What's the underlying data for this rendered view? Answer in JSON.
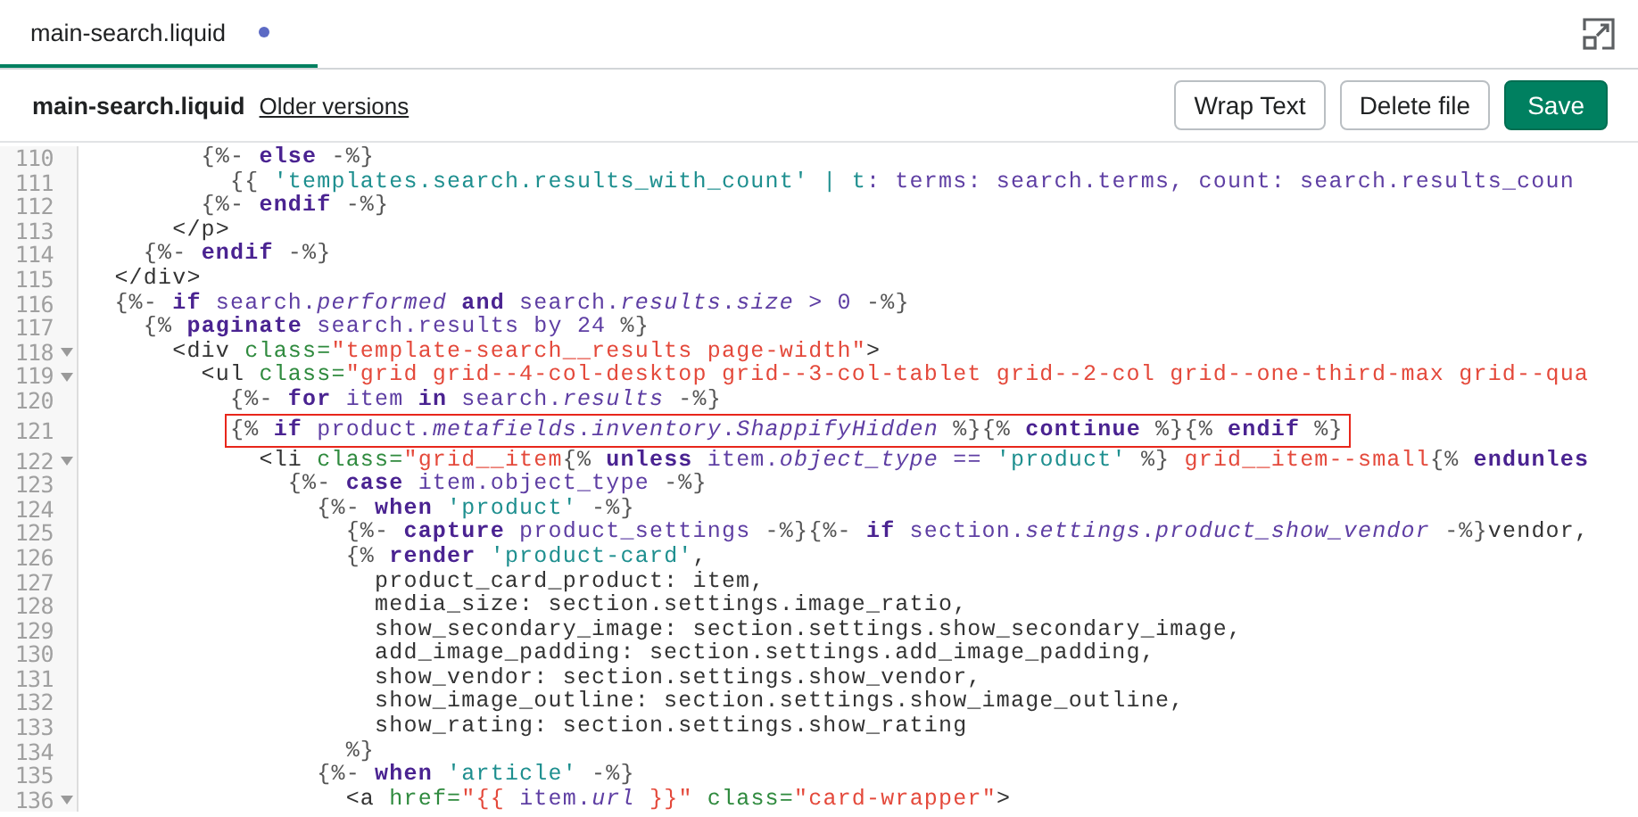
{
  "tabs": [
    {
      "label": "main-search.liquid",
      "selected": true,
      "unsaved": true
    }
  ],
  "toolbar": {
    "file_name": "main-search.liquid",
    "link": "Older versions",
    "buttons": [
      {
        "label": "Wrap Text",
        "kind": "secondary"
      },
      {
        "label": "Delete file",
        "kind": "secondary"
      },
      {
        "label": "Save",
        "kind": "primary"
      }
    ]
  },
  "editor": {
    "lines": [
      {
        "number": "110",
        "foldable": false,
        "highlighted": false,
        "tokens": [
          {
            "kind": "delim",
            "text": "        {%- "
          },
          {
            "kind": "keyword",
            "text": "else"
          },
          {
            "kind": "delim",
            "text": " -%}"
          }
        ]
      },
      {
        "number": "111",
        "foldable": false,
        "highlighted": false,
        "tokens": [
          {
            "kind": "delim",
            "text": "          {{ "
          },
          {
            "kind": "string",
            "text": "'templates.search.results_with_count'"
          },
          {
            "kind": "string",
            "text": " | t"
          },
          {
            "kind": "var",
            "text": ": terms: search.terms, count: search.results_coun"
          }
        ]
      },
      {
        "number": "112",
        "foldable": false,
        "highlighted": false,
        "tokens": [
          {
            "kind": "delim",
            "text": "        {%- "
          },
          {
            "kind": "keyword",
            "text": "endif"
          },
          {
            "kind": "delim",
            "text": " -%}"
          }
        ]
      },
      {
        "number": "113",
        "foldable": false,
        "highlighted": false,
        "tokens": [
          {
            "kind": "tag",
            "text": "      </p>"
          }
        ]
      },
      {
        "number": "114",
        "foldable": false,
        "highlighted": false,
        "tokens": [
          {
            "kind": "delim",
            "text": "    {%- "
          },
          {
            "kind": "keyword",
            "text": "endif"
          },
          {
            "kind": "delim",
            "text": " -%}"
          }
        ]
      },
      {
        "number": "115",
        "foldable": false,
        "highlighted": false,
        "tokens": [
          {
            "kind": "tag",
            "text": "  </div>"
          }
        ]
      },
      {
        "number": "116",
        "foldable": false,
        "highlighted": false,
        "tokens": [
          {
            "kind": "delim",
            "text": "  {%- "
          },
          {
            "kind": "keyword",
            "text": "if"
          },
          {
            "kind": "var",
            "text": " search."
          },
          {
            "kind": "prop",
            "text": "performed"
          },
          {
            "kind": "keyword",
            "text": " and"
          },
          {
            "kind": "var",
            "text": " search."
          },
          {
            "kind": "prop",
            "text": "results"
          },
          {
            "kind": "var",
            "text": "."
          },
          {
            "kind": "prop",
            "text": "size"
          },
          {
            "kind": "var",
            "text": " > 0"
          },
          {
            "kind": "delim",
            "text": " -%}"
          }
        ]
      },
      {
        "number": "117",
        "foldable": false,
        "highlighted": false,
        "tokens": [
          {
            "kind": "delim",
            "text": "    {% "
          },
          {
            "kind": "keyword",
            "text": "paginate"
          },
          {
            "kind": "var",
            "text": " search.results by 24"
          },
          {
            "kind": "delim",
            "text": " %}"
          }
        ]
      },
      {
        "number": "118",
        "foldable": true,
        "highlighted": false,
        "tokens": [
          {
            "kind": "tag",
            "text": "      <div "
          },
          {
            "kind": "attr",
            "text": "class="
          },
          {
            "kind": "value",
            "text": "\"template-search__results page-width\""
          },
          {
            "kind": "tag",
            "text": ">"
          }
        ]
      },
      {
        "number": "119",
        "foldable": true,
        "highlighted": false,
        "tokens": [
          {
            "kind": "tag",
            "text": "        <ul "
          },
          {
            "kind": "attr",
            "text": "class="
          },
          {
            "kind": "value",
            "text": "\"grid grid--4-col-desktop grid--3-col-tablet grid--2-col grid--one-third-max grid--qua"
          }
        ]
      },
      {
        "number": "120",
        "foldable": false,
        "highlighted": false,
        "tokens": [
          {
            "kind": "delim",
            "text": "          {%- "
          },
          {
            "kind": "keyword",
            "text": "for"
          },
          {
            "kind": "var",
            "text": " item "
          },
          {
            "kind": "keyword",
            "text": "in"
          },
          {
            "kind": "var",
            "text": " search."
          },
          {
            "kind": "prop",
            "text": "results"
          },
          {
            "kind": "delim",
            "text": " -%}"
          }
        ]
      },
      {
        "number": "121",
        "foldable": false,
        "highlighted": true,
        "tokens": [
          {
            "kind": "delim",
            "text": "{% "
          },
          {
            "kind": "keyword",
            "text": "if"
          },
          {
            "kind": "var",
            "text": " product."
          },
          {
            "kind": "prop",
            "text": "metafields"
          },
          {
            "kind": "var",
            "text": "."
          },
          {
            "kind": "prop",
            "text": "inventory"
          },
          {
            "kind": "var",
            "text": "."
          },
          {
            "kind": "prop",
            "text": "ShappifyHidden"
          },
          {
            "kind": "delim",
            "text": " %}{% "
          },
          {
            "kind": "keyword",
            "text": "continue"
          },
          {
            "kind": "delim",
            "text": " %}{% "
          },
          {
            "kind": "keyword",
            "text": "endif"
          },
          {
            "kind": "delim",
            "text": " %}"
          }
        ]
      },
      {
        "number": "122",
        "foldable": true,
        "highlighted": false,
        "tokens": [
          {
            "kind": "tag",
            "text": "            <li "
          },
          {
            "kind": "attr",
            "text": "class="
          },
          {
            "kind": "value",
            "text": "\"grid__item"
          },
          {
            "kind": "delim",
            "text": "{% "
          },
          {
            "kind": "keyword",
            "text": "unless"
          },
          {
            "kind": "var",
            "text": " item."
          },
          {
            "kind": "prop",
            "text": "object_type"
          },
          {
            "kind": "var",
            "text": " == "
          },
          {
            "kind": "string",
            "text": "'product'"
          },
          {
            "kind": "delim",
            "text": " %}"
          },
          {
            "kind": "value",
            "text": " grid__item--small"
          },
          {
            "kind": "delim",
            "text": "{% "
          },
          {
            "kind": "keyword",
            "text": "endunles"
          }
        ]
      },
      {
        "number": "123",
        "foldable": false,
        "highlighted": false,
        "tokens": [
          {
            "kind": "delim",
            "text": "              {%- "
          },
          {
            "kind": "keyword",
            "text": "case"
          },
          {
            "kind": "var",
            "text": " item.object_type"
          },
          {
            "kind": "delim",
            "text": " -%}"
          }
        ]
      },
      {
        "number": "124",
        "foldable": false,
        "highlighted": false,
        "tokens": [
          {
            "kind": "delim",
            "text": "                {%- "
          },
          {
            "kind": "keyword",
            "text": "when"
          },
          {
            "kind": "string",
            "text": " 'product'"
          },
          {
            "kind": "delim",
            "text": " -%}"
          }
        ]
      },
      {
        "number": "125",
        "foldable": false,
        "highlighted": false,
        "tokens": [
          {
            "kind": "delim",
            "text": "                  {%- "
          },
          {
            "kind": "keyword",
            "text": "capture"
          },
          {
            "kind": "var",
            "text": " product_settings"
          },
          {
            "kind": "delim",
            "text": " -%}{%- "
          },
          {
            "kind": "keyword",
            "text": "if"
          },
          {
            "kind": "var",
            "text": " section."
          },
          {
            "kind": "prop",
            "text": "settings"
          },
          {
            "kind": "var",
            "text": "."
          },
          {
            "kind": "prop",
            "text": "product_show_vendor"
          },
          {
            "kind": "delim",
            "text": " -%}"
          },
          {
            "kind": "text",
            "text": "vendor,"
          }
        ]
      },
      {
        "number": "126",
        "foldable": false,
        "highlighted": false,
        "tokens": [
          {
            "kind": "delim",
            "text": "                  {% "
          },
          {
            "kind": "keyword",
            "text": "render"
          },
          {
            "kind": "string",
            "text": " 'product-card'"
          },
          {
            "kind": "text",
            "text": ","
          }
        ]
      },
      {
        "number": "127",
        "foldable": false,
        "highlighted": false,
        "tokens": [
          {
            "kind": "text",
            "text": "                    product_card_product: item,"
          }
        ]
      },
      {
        "number": "128",
        "foldable": false,
        "highlighted": false,
        "tokens": [
          {
            "kind": "text",
            "text": "                    media_size: section.settings.image_ratio,"
          }
        ]
      },
      {
        "number": "129",
        "foldable": false,
        "highlighted": false,
        "tokens": [
          {
            "kind": "text",
            "text": "                    show_secondary_image: section.settings.show_secondary_image,"
          }
        ]
      },
      {
        "number": "130",
        "foldable": false,
        "highlighted": false,
        "tokens": [
          {
            "kind": "text",
            "text": "                    add_image_padding: section.settings.add_image_padding,"
          }
        ]
      },
      {
        "number": "131",
        "foldable": false,
        "highlighted": false,
        "tokens": [
          {
            "kind": "text",
            "text": "                    show_vendor: section.settings.show_vendor,"
          }
        ]
      },
      {
        "number": "132",
        "foldable": false,
        "highlighted": false,
        "tokens": [
          {
            "kind": "text",
            "text": "                    show_image_outline: section.settings.show_image_outline,"
          }
        ]
      },
      {
        "number": "133",
        "foldable": false,
        "highlighted": false,
        "tokens": [
          {
            "kind": "text",
            "text": "                    show_rating: section.settings.show_rating"
          }
        ]
      },
      {
        "number": "134",
        "foldable": false,
        "highlighted": false,
        "tokens": [
          {
            "kind": "delim",
            "text": "                  %}"
          }
        ]
      },
      {
        "number": "135",
        "foldable": false,
        "highlighted": false,
        "tokens": [
          {
            "kind": "delim",
            "text": "                {%- "
          },
          {
            "kind": "keyword",
            "text": "when"
          },
          {
            "kind": "string",
            "text": " 'article'"
          },
          {
            "kind": "delim",
            "text": " -%}"
          }
        ]
      },
      {
        "number": "136",
        "foldable": true,
        "highlighted": false,
        "tokens": [
          {
            "kind": "tag",
            "text": "                  <a "
          },
          {
            "kind": "attr",
            "text": "href="
          },
          {
            "kind": "value",
            "text": "\"{{ "
          },
          {
            "kind": "var",
            "text": "item."
          },
          {
            "kind": "prop",
            "text": "url"
          },
          {
            "kind": "value",
            "text": " }}\""
          },
          {
            "kind": "attr",
            "text": " class="
          },
          {
            "kind": "value",
            "text": "\"card-wrapper\""
          },
          {
            "kind": "tag",
            "text": ">"
          }
        ]
      }
    ]
  }
}
